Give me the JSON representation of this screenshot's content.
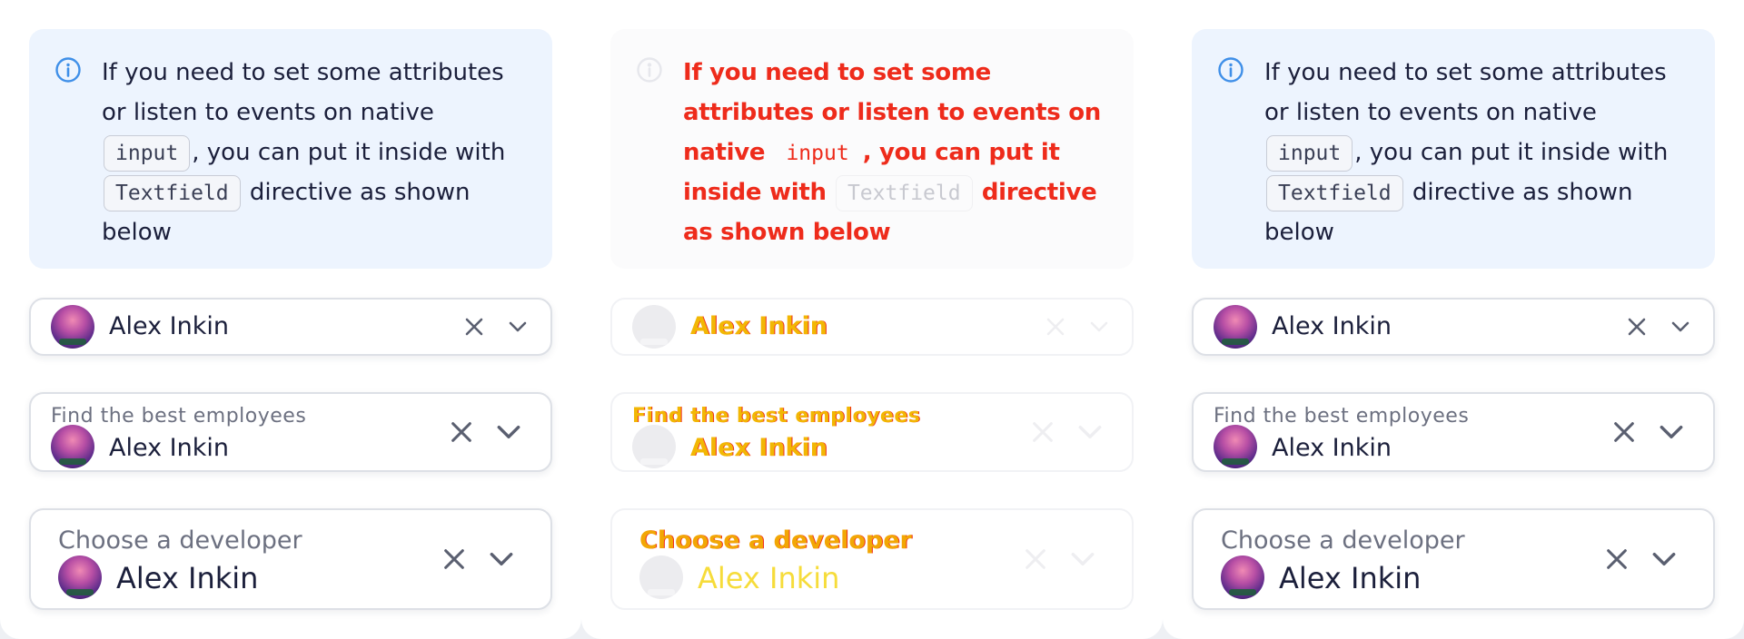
{
  "notice": {
    "text_part1": "If you need to set some attributes or listen to events on native",
    "code_input": "input",
    "text_part2": ", you can put it inside with",
    "code_textfield": "Textfield",
    "text_part3": "directive as shown below"
  },
  "fields": {
    "basic": {
      "value": "Alex Inkin"
    },
    "with_label": {
      "label": "Find the best employees",
      "value": "Alex Inkin"
    },
    "large": {
      "label": "Choose a developer",
      "value": "Alex Inkin"
    }
  },
  "icons": {
    "info": "info-icon",
    "clear": "close-icon",
    "expand": "chevron-down-icon"
  },
  "colors": {
    "notice_background": "#edf4fe",
    "info_icon": "#3f8fe8",
    "diff_red": "#ee2b1b",
    "diff_yellow": "#f2b705"
  }
}
